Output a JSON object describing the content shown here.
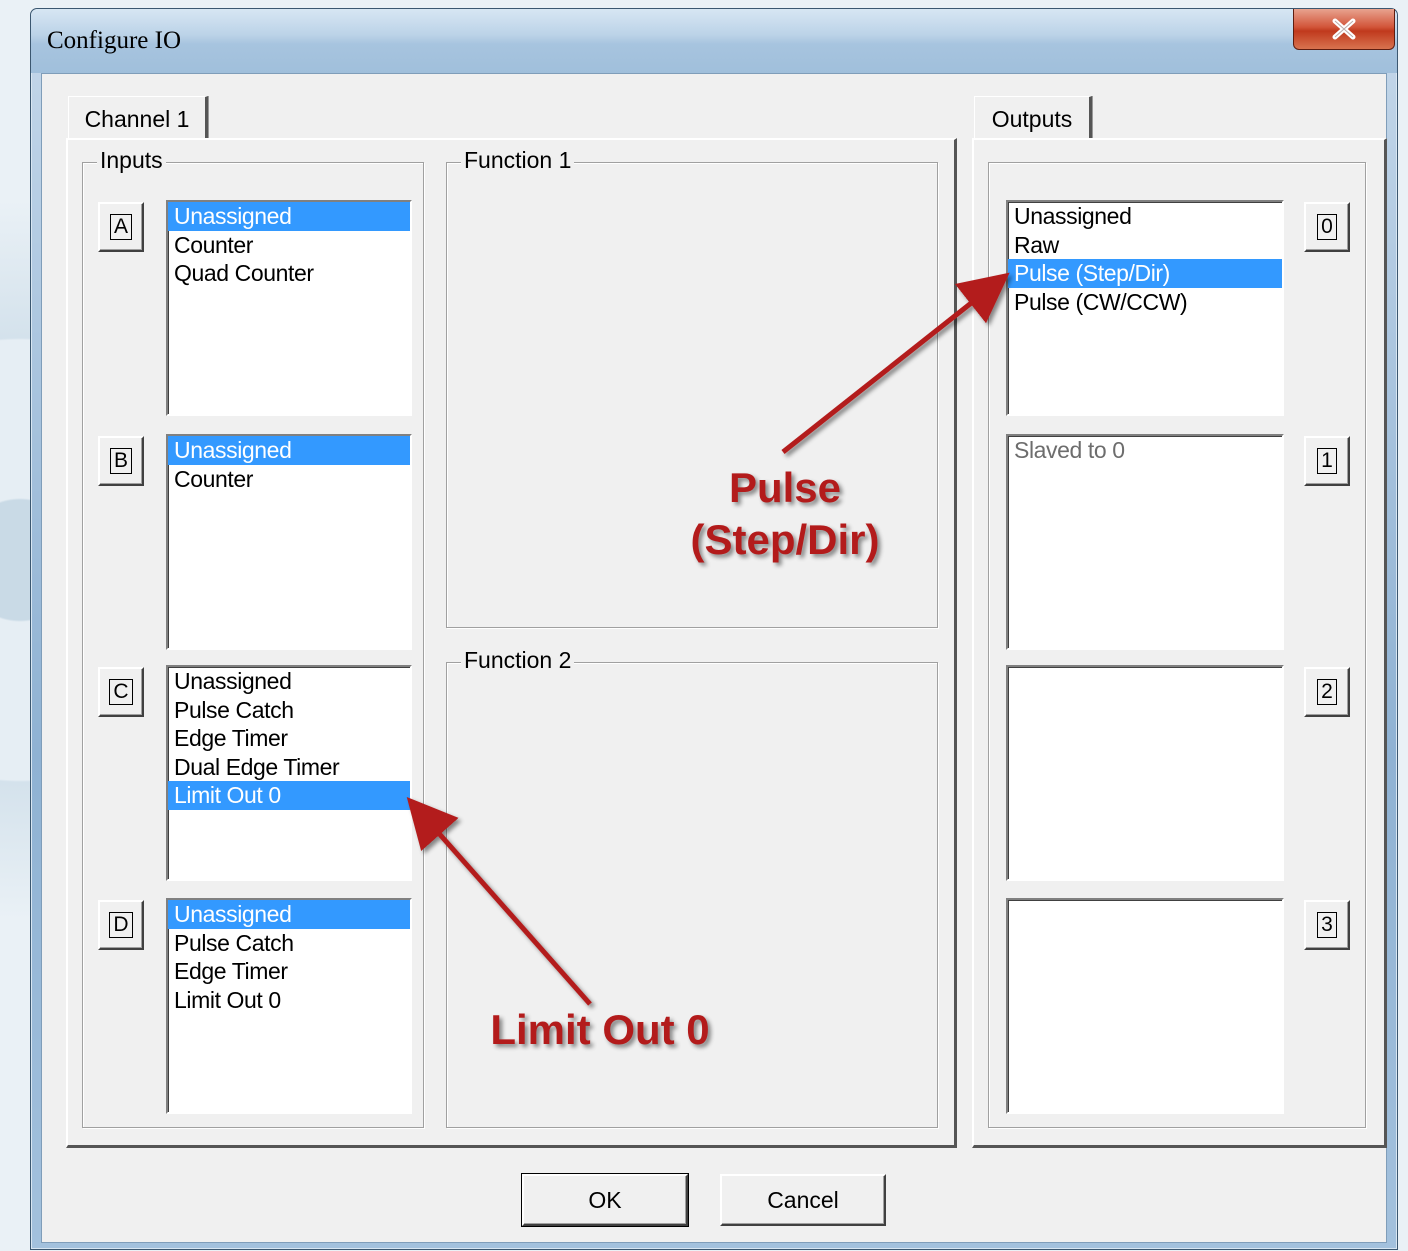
{
  "window": {
    "title": "Configure IO"
  },
  "tabs": {
    "channel": "Channel 1",
    "outputs": "Outputs"
  },
  "groups": {
    "inputs": "Inputs",
    "function1": "Function 1",
    "function2": "Function 2"
  },
  "inputs": [
    {
      "button": "A",
      "items": [
        "Unassigned",
        "Counter",
        "Quad Counter"
      ],
      "selected": 0
    },
    {
      "button": "B",
      "items": [
        "Unassigned",
        "Counter"
      ],
      "selected": 0
    },
    {
      "button": "C",
      "items": [
        "Unassigned",
        "Pulse Catch",
        "Edge Timer",
        "Dual Edge Timer",
        "Limit Out 0"
      ],
      "selected": 4
    },
    {
      "button": "D",
      "items": [
        "Unassigned",
        "Pulse Catch",
        "Edge Timer",
        "Limit Out 0"
      ],
      "selected": 0
    }
  ],
  "outputs": [
    {
      "button": "0",
      "items": [
        "Unassigned",
        "Raw",
        "Pulse (Step/Dir)",
        "Pulse (CW/CCW)"
      ],
      "selected": 2
    },
    {
      "button": "1",
      "items": [
        "Slaved to 0"
      ],
      "selected": null,
      "disabled": true
    },
    {
      "button": "2",
      "items": [],
      "selected": null
    },
    {
      "button": "3",
      "items": [],
      "selected": null
    }
  ],
  "buttons": {
    "ok": "OK",
    "cancel": "Cancel"
  },
  "annotations": {
    "pulse_line1": "Pulse",
    "pulse_line2": "(Step/Dir)",
    "limit": "Limit Out 0"
  },
  "colors": {
    "selection": "#3399ff",
    "annotation": "#b31b1b",
    "dialog_face": "#f0f0f0"
  }
}
